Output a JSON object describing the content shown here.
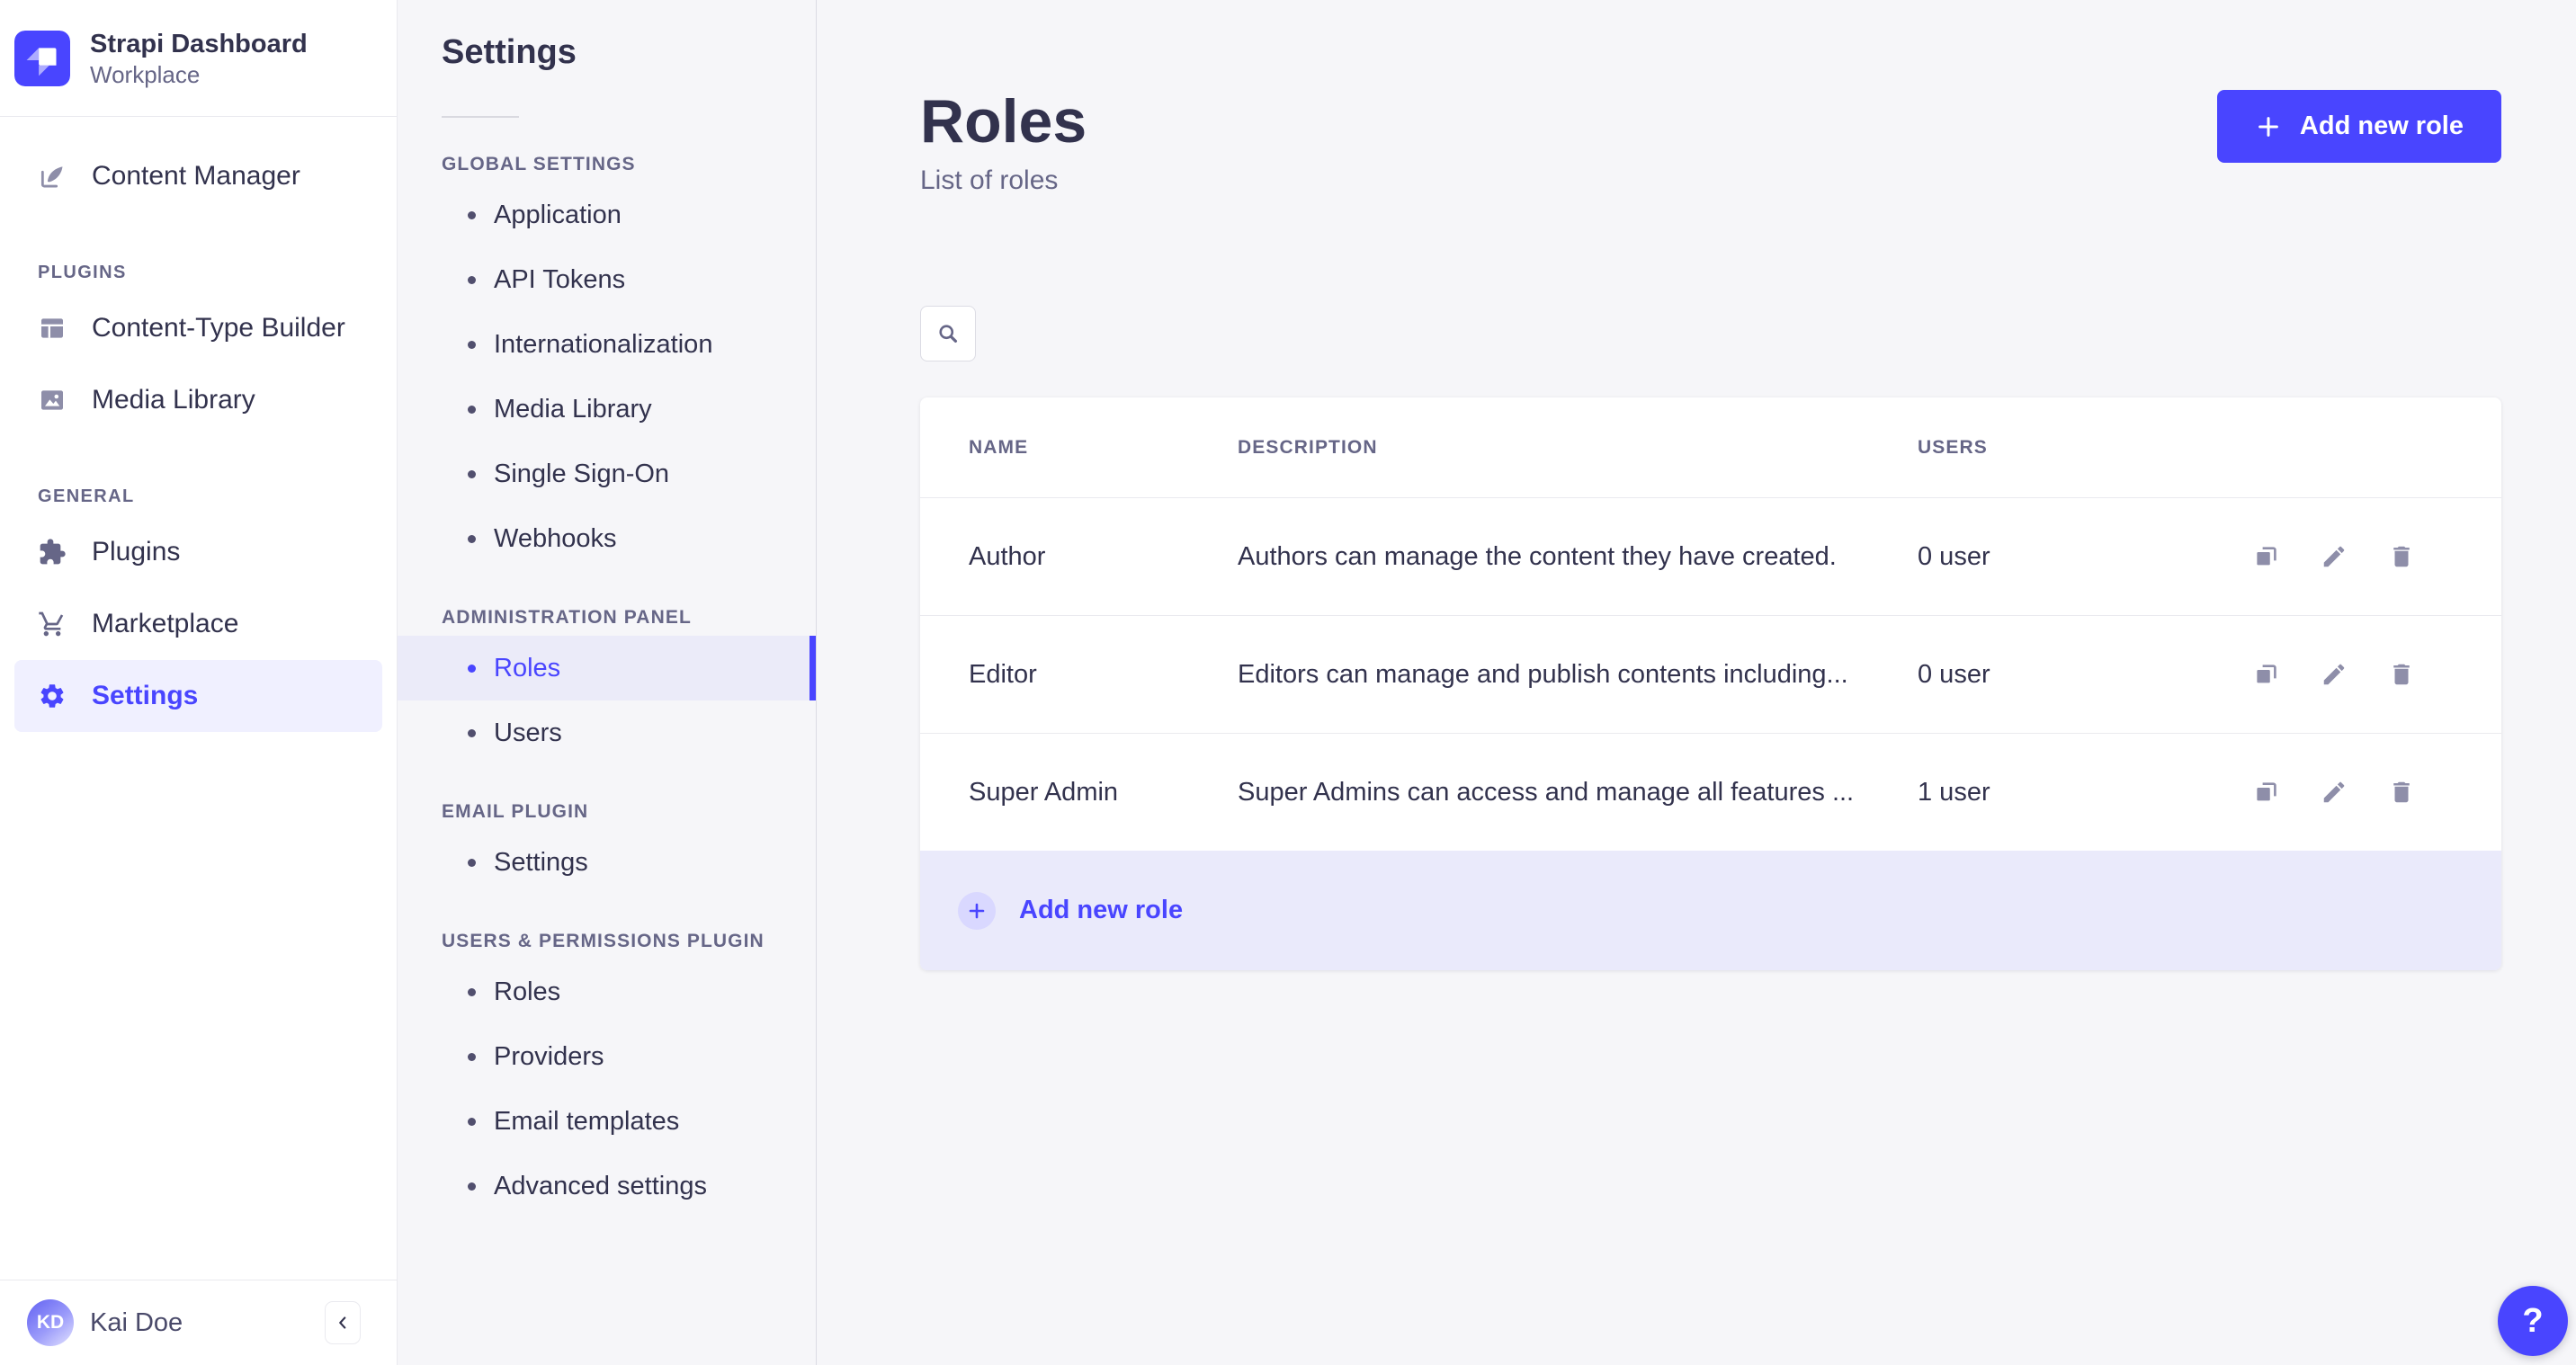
{
  "brand": {
    "title": "Strapi Dashboard",
    "subtitle": "Workplace"
  },
  "sidebar": {
    "content_manager": "Content Manager",
    "sections": [
      {
        "label": "PLUGINS",
        "items": [
          "Content-Type Builder",
          "Media Library"
        ]
      },
      {
        "label": "GENERAL",
        "items": [
          "Plugins",
          "Marketplace",
          "Settings"
        ]
      }
    ],
    "active_item": "Settings"
  },
  "user": {
    "initials": "KD",
    "name": "Kai Doe"
  },
  "subnav": {
    "title": "Settings",
    "sections": [
      {
        "label": "GLOBAL SETTINGS",
        "items": [
          "Application",
          "API Tokens",
          "Internationalization",
          "Media Library",
          "Single Sign-On",
          "Webhooks"
        ]
      },
      {
        "label": "ADMINISTRATION PANEL",
        "items": [
          "Roles",
          "Users"
        ],
        "active": "Roles"
      },
      {
        "label": "EMAIL PLUGIN",
        "items": [
          "Settings"
        ]
      },
      {
        "label": "USERS & PERMISSIONS PLUGIN",
        "items": [
          "Roles",
          "Providers",
          "Email templates",
          "Advanced settings"
        ]
      }
    ]
  },
  "page": {
    "title": "Roles",
    "subtitle": "List of roles",
    "add_button_label": "Add new role"
  },
  "table": {
    "headers": [
      "NAME",
      "DESCRIPTION",
      "USERS"
    ],
    "rows": [
      {
        "name": "Author",
        "description": "Authors can manage the content they have created.",
        "users": "0 user"
      },
      {
        "name": "Editor",
        "description": "Editors can manage and publish contents including...",
        "users": "0 user"
      },
      {
        "name": "Super Admin",
        "description": "Super Admins can access and manage all features ...",
        "users": "1 user"
      }
    ],
    "footer_add_label": "Add new role"
  },
  "help_label": "?",
  "colors": {
    "accent": "#4945ff",
    "accent_light": "#d9d8ff",
    "accent_bg": "#f0f0ff",
    "text_dark": "#32324d",
    "text_gray": "#666687",
    "icon_gray": "#8e8ea9",
    "border": "#dcdce4",
    "background": "#f6f6f9"
  }
}
